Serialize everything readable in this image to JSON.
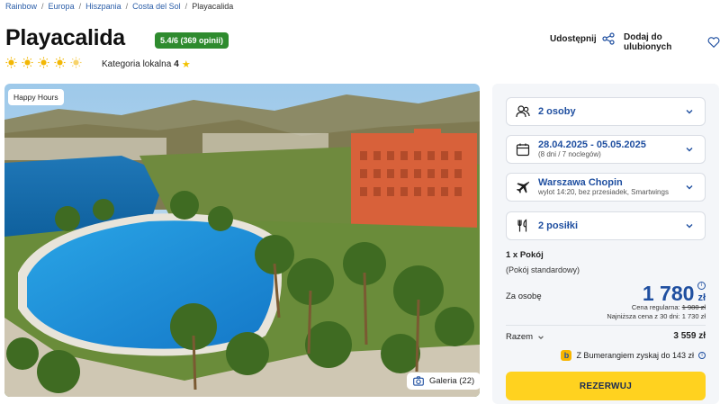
{
  "breadcrumb": [
    "Rainbow",
    "Europa",
    "Hiszpania",
    "Costa del Sol",
    "Playacalida"
  ],
  "hotel": {
    "name": "Playacalida",
    "rating": "5.4/6 (369 opinii)",
    "category_label": "Kategoria lokalna",
    "category_value": "4",
    "suns": 5
  },
  "actions": {
    "share": "Udostępnij",
    "favorite": "Dodaj do ulubionych"
  },
  "photo": {
    "tag": "Happy Hours",
    "gallery": "Galeria (22)"
  },
  "booking": {
    "persons": "2 osoby",
    "dates": "28.04.2025 - 05.05.2025",
    "dates_sub": "(8 dni / 7 noclegów)",
    "departure": "Warszawa Chopin",
    "departure_sub": "wylot 14:20, bez przesiadek, Smartwings",
    "meals": "2 posiłki",
    "room": "1 x Pokój",
    "room_type": "(Pokój standardowy)",
    "per_person_label": "Za osobę",
    "price": "1 780",
    "currency": "zł",
    "regular_label": "Cena regularna:",
    "regular_price": "1 980 zł",
    "lowest_label": "Najniższa cena z 30 dni:",
    "lowest_price": "1 730 zł",
    "total_label": "Razem",
    "total_value": "3 559 zł",
    "bumerang_text": "Z Bumerangiem zyskaj do 143 zł",
    "reserve_button": "REZERWUJ"
  },
  "colors": {
    "brand_blue": "#1f4fa0",
    "rating_green": "#2e8b2e",
    "reserve_yellow": "#ffd21f",
    "sun_yellow": "#f2b705"
  }
}
